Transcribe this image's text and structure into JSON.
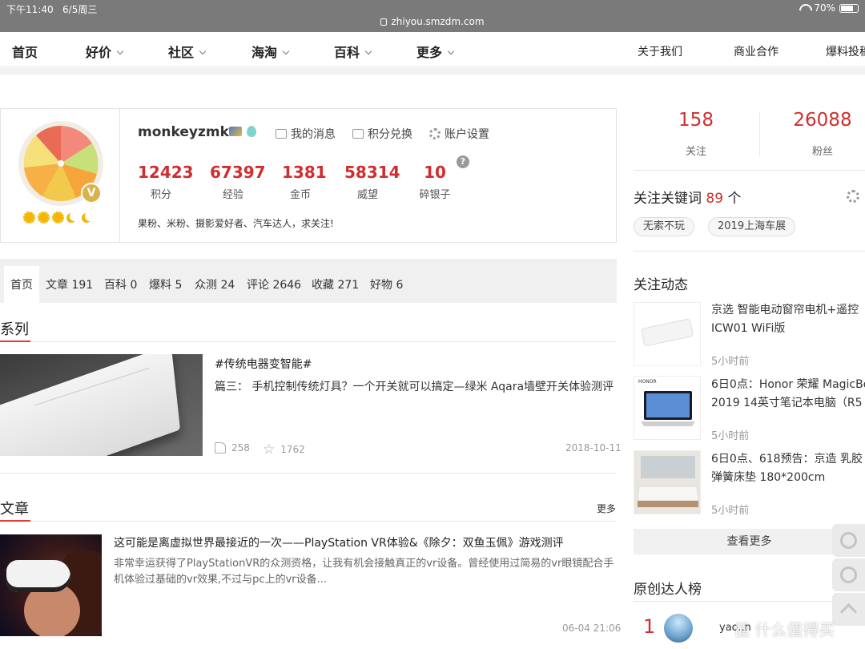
{
  "status_bar": {
    "time": "下午11:40",
    "date": "6/5周三",
    "url": "zhiyou.smzdm.com",
    "battery": "70%"
  },
  "nav": {
    "items": [
      {
        "label": "首页"
      },
      {
        "label": "好价"
      },
      {
        "label": "社区"
      },
      {
        "label": "海淘"
      },
      {
        "label": "百科"
      },
      {
        "label": "更多"
      }
    ],
    "right": [
      {
        "label": "关于我们"
      },
      {
        "label": "商业合作"
      },
      {
        "label": "爆料投稿"
      }
    ]
  },
  "profile": {
    "username": "monkeyzmk",
    "actions": [
      {
        "label": "我的消息"
      },
      {
        "label": "积分兑换"
      },
      {
        "label": "账户设置"
      }
    ],
    "stats": [
      {
        "value": "12423",
        "label": "积分"
      },
      {
        "value": "67397",
        "label": "经验"
      },
      {
        "value": "1381",
        "label": "金币"
      },
      {
        "value": "58314",
        "label": "威望"
      },
      {
        "value": "10",
        "label": "碎银子"
      }
    ],
    "help": "?",
    "bio": "果粉、米粉、摄影爱好者、汽车达人，求关注!",
    "badge": "V"
  },
  "tabs": [
    {
      "label": "首页"
    },
    {
      "label": "文章 191"
    },
    {
      "label": "百科 0"
    },
    {
      "label": "爆料 5"
    },
    {
      "label": "众测 24"
    },
    {
      "label": "评论 2646"
    },
    {
      "label": "收藏 271"
    },
    {
      "label": "好物 6"
    }
  ],
  "series": {
    "heading": "系列",
    "hashtag": "#传统电器变智能#",
    "title": "篇三：  手机控制传统灯具？一个开关就可以搞定—绿米 Aqara墙壁开关体验测评",
    "likes": "258",
    "favs": "1762",
    "date": "2018-10-11"
  },
  "articles": {
    "heading": "文章",
    "more": "更多",
    "item": {
      "title": "这可能是离虚拟世界最接近的一次——PlayStation VR体验&《除夕：双鱼玉佩》游戏测评",
      "desc": "非常幸运获得了PlayStationVR的众测资格，让我有机会接触真正的vr设备。曾经使用过简易的vr眼镜配合手机体验过基础的vr效果,不过与pc上的vr设备...",
      "date": "06-04 21:06"
    }
  },
  "sidebar": {
    "follow_count": "158",
    "follow_label": "关注",
    "fans_count": "26088",
    "fans_label": "粉丝",
    "keywords_title": "关注关键词",
    "keywords_count": "89",
    "keywords_unit": "个",
    "keywords": [
      "无索不玩",
      "2019上海车展"
    ],
    "feed_title": "关注动态",
    "feed": [
      {
        "text1": "京选 智能电动窗帘电机+遥控",
        "text2": "ICW01 WiFi版",
        "time": "5小时前"
      },
      {
        "text1": "6日0点：Honor 荣耀 MagicBo",
        "text2": "2019 14英寸笔记本电脑（R5",
        "time": "5小时前",
        "brand": "HONOR"
      },
      {
        "text1": "6日0点、618预告：京造 乳胶",
        "text2": "弹簧床垫 180*200cm",
        "time": "5小时前"
      }
    ],
    "see_more": "查看更多",
    "rank_title": "原创达人榜",
    "rank": [
      {
        "num": "1",
        "name": "yao..n"
      }
    ]
  },
  "watermark": "值 什么值得买",
  "colors": {
    "accent": "#d02e2e",
    "underline": "#e3393c"
  }
}
